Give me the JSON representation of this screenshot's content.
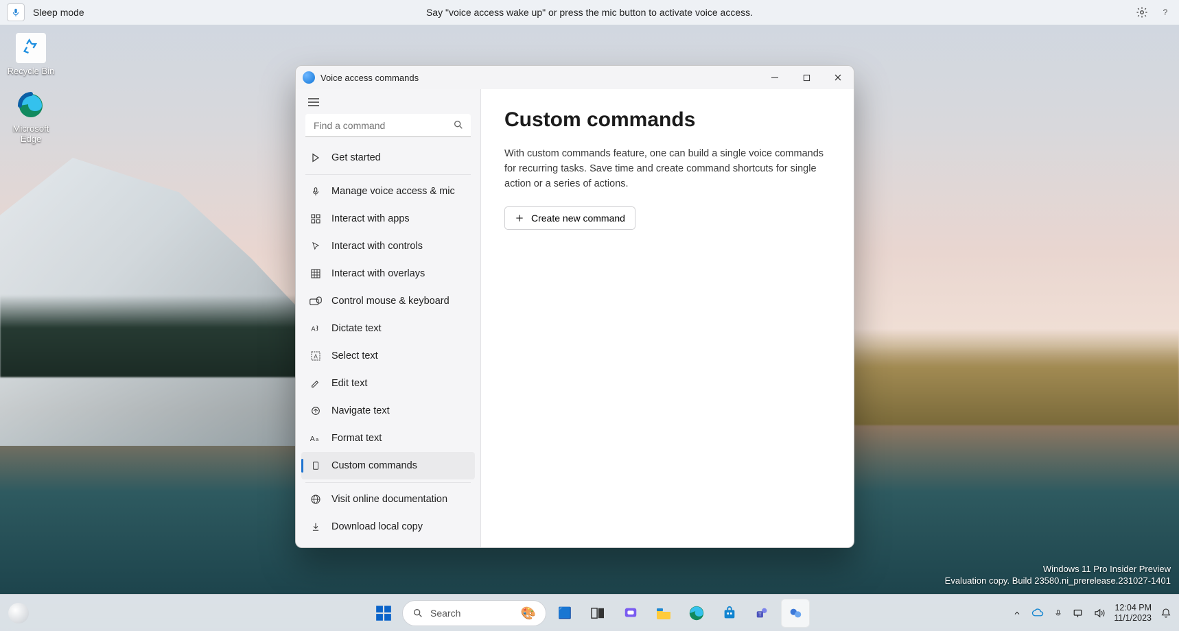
{
  "voice_bar": {
    "mode": "Sleep mode",
    "hint": "Say \"voice access wake up\" or press the mic button to activate voice access."
  },
  "desktop_icons": {
    "recycle": "Recycle Bin",
    "edge": "Microsoft Edge"
  },
  "window": {
    "title": "Voice access commands",
    "search_placeholder": "Find a command",
    "nav": {
      "get_started": "Get started",
      "manage": "Manage voice access & mic",
      "apps": "Interact with apps",
      "controls": "Interact with controls",
      "overlays": "Interact with overlays",
      "mouse_kb": "Control mouse & keyboard",
      "dictate": "Dictate text",
      "select": "Select text",
      "edit": "Edit text",
      "navigate": "Navigate text",
      "format": "Format text",
      "custom": "Custom commands",
      "docs": "Visit online documentation",
      "download": "Download local copy"
    },
    "content": {
      "heading": "Custom commands",
      "description": "With custom commands feature, one can build a single voice commands for recurring tasks. Save time and create command shortcuts for single action or a series of actions.",
      "create_label": "Create new command"
    }
  },
  "watermark": {
    "line1": "Windows 11 Pro Insider Preview",
    "line2": "Evaluation copy. Build 23580.ni_prerelease.231027-1401"
  },
  "taskbar": {
    "search_placeholder": "Search",
    "clock_time": "12:04 PM",
    "clock_date": "11/1/2023"
  }
}
